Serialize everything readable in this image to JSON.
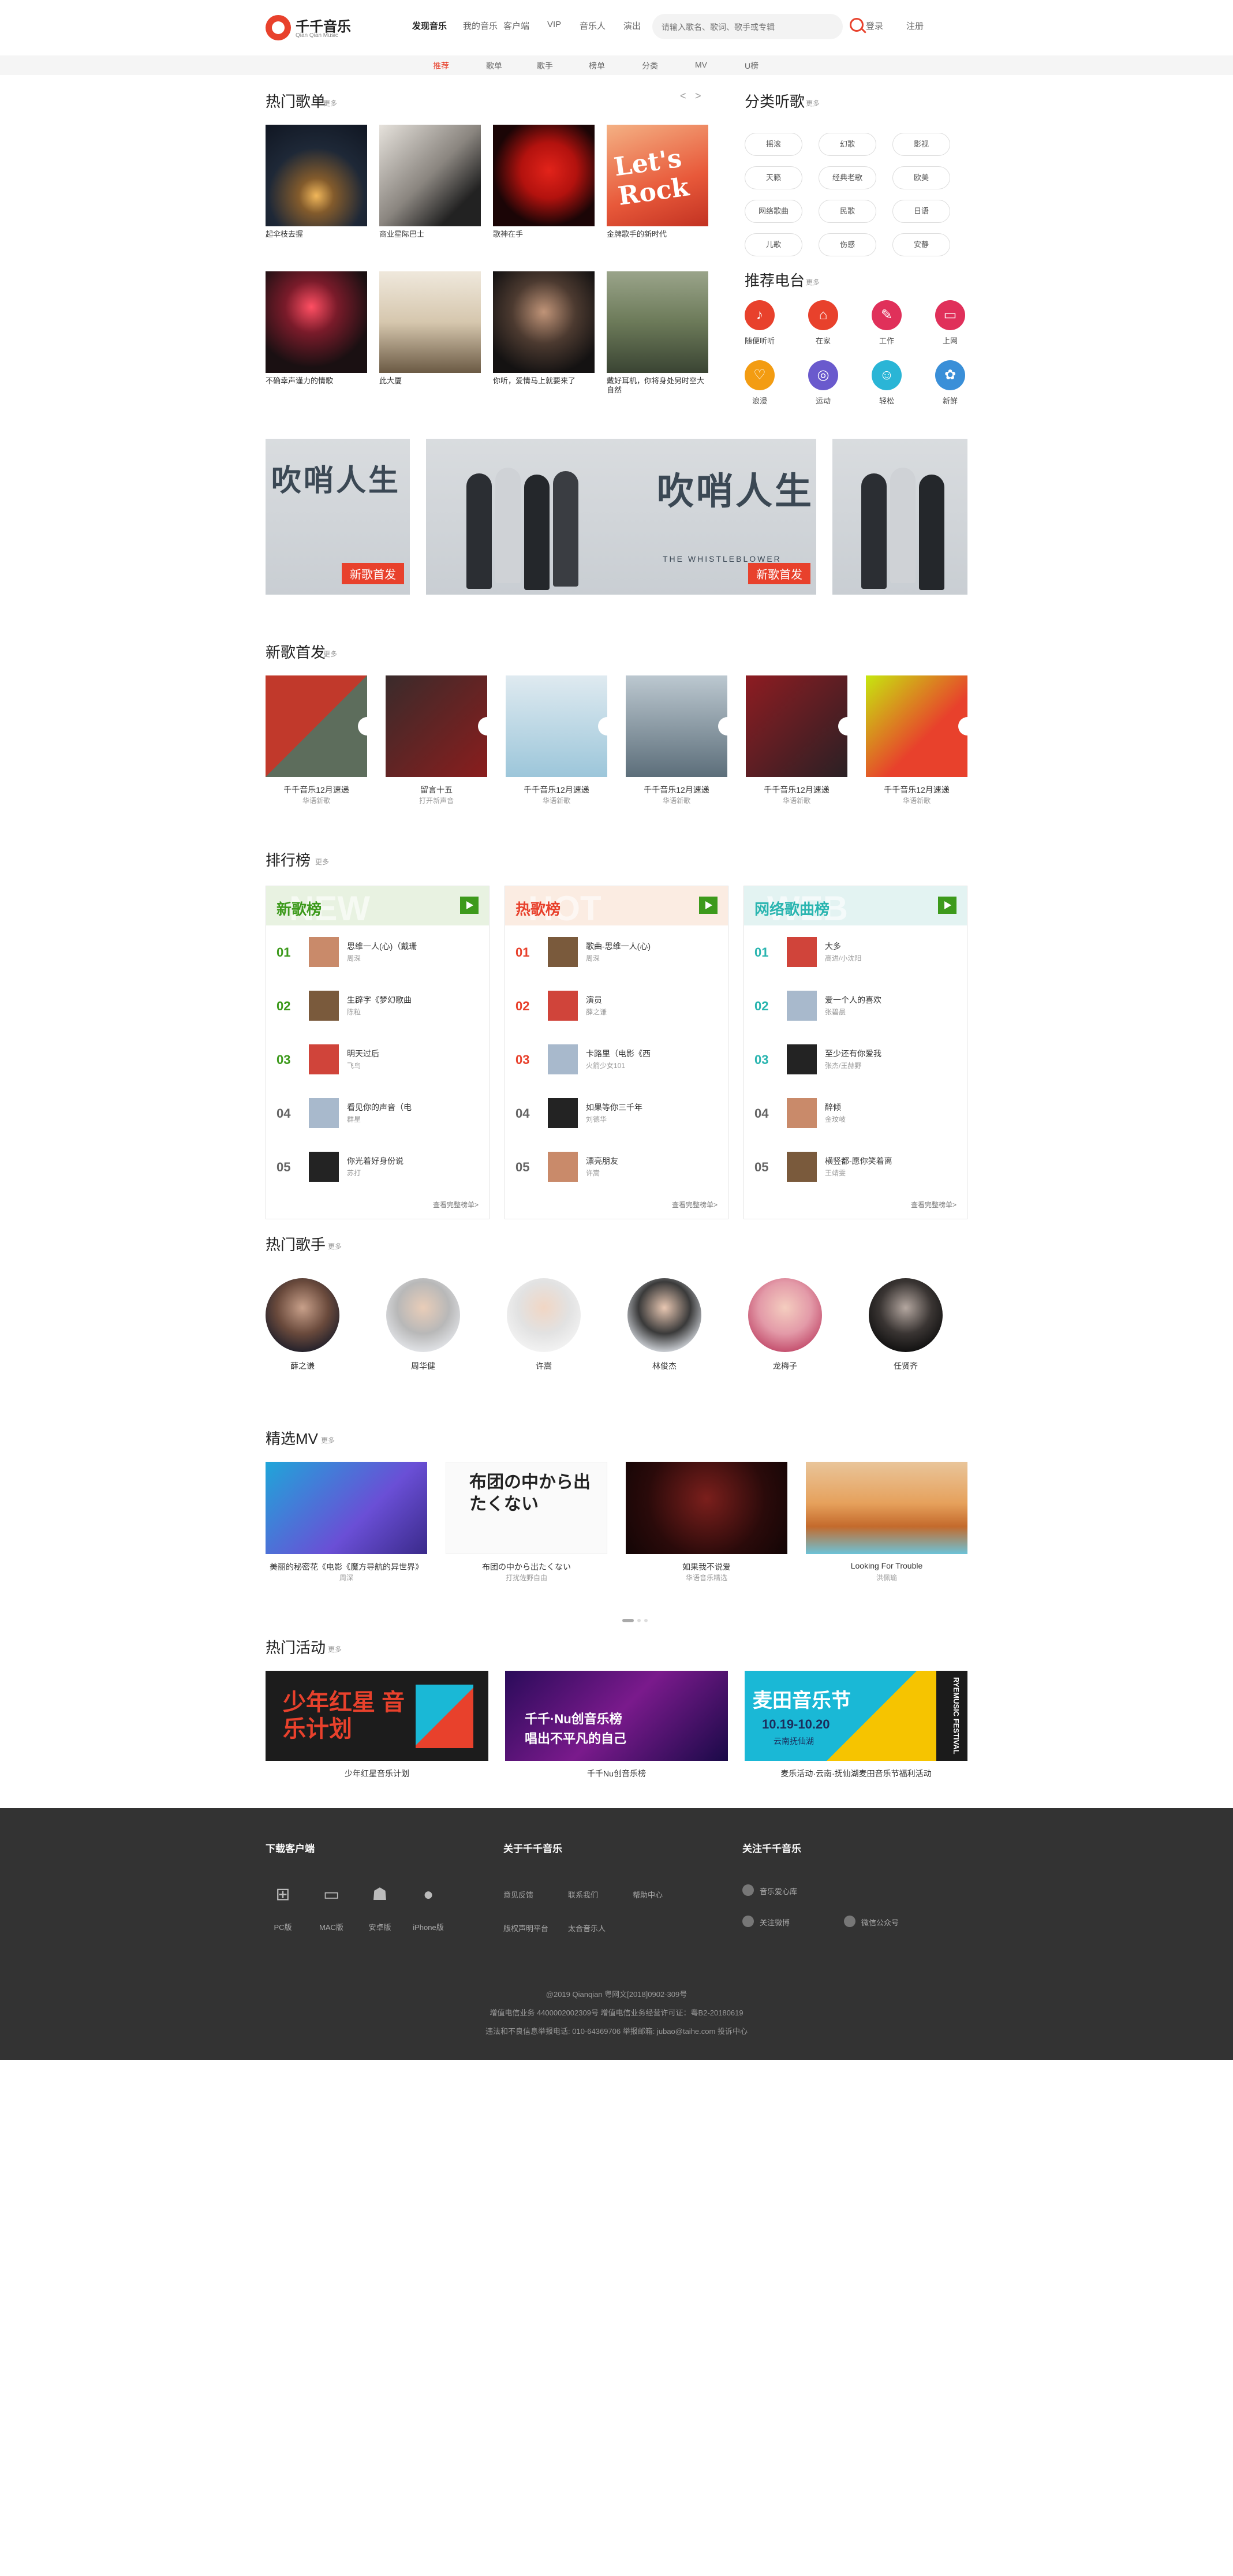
{
  "header": {
    "logo_cn": "千千音乐",
    "logo_en": "Qian Qian Music",
    "nav": [
      "发现音乐",
      "我的音乐",
      "客户端",
      "VIP",
      "音乐人",
      "演出"
    ],
    "search_placeholder": "请输入歌名、歌词、歌手或专辑",
    "login": "登录",
    "register": "注册"
  },
  "subnav": [
    "推荐",
    "歌单",
    "歌手",
    "榜单",
    "分类",
    "MV",
    "U榜"
  ],
  "more_label": "更多",
  "playlists": {
    "title": "热门歌单",
    "pager": [
      "<",
      ">"
    ],
    "items": [
      "起伞枝去握",
      "商业星际巴士",
      "歌神在手",
      "金牌歌手的新时代",
      "不确幸声谨力的情歌",
      "此大厦",
      "你听，爱情马上就要来了",
      "戴好耳机，你将身处另时空大自然"
    ]
  },
  "genres": {
    "title": "分类听歌",
    "items": [
      "摇滚",
      "幻歌",
      "影视",
      "天籁",
      "经典老歌",
      "欧美",
      "网络歌曲",
      "民歌",
      "日语",
      "儿歌",
      "伤感",
      "安静"
    ]
  },
  "radio": {
    "title": "推荐电台",
    "items": [
      {
        "label": "随便听听",
        "color": "#e8412c",
        "glyph": "♪"
      },
      {
        "label": "在家",
        "color": "#e8412c",
        "glyph": "⌂"
      },
      {
        "label": "工作",
        "color": "#e0305a",
        "glyph": "✎"
      },
      {
        "label": "上网",
        "color": "#e0305a",
        "glyph": "▭"
      },
      {
        "label": "浪漫",
        "color": "#f39c12",
        "glyph": "♡"
      },
      {
        "label": "运动",
        "color": "#6a5acd",
        "glyph": "◎"
      },
      {
        "label": "轻松",
        "color": "#2ab5d6",
        "glyph": "☺"
      },
      {
        "label": "新鲜",
        "color": "#3a8fd8",
        "glyph": "✿"
      }
    ]
  },
  "banner": {
    "title_cn": "吹哨人生",
    "title_en": "THE WHISTLEBLOWER",
    "badge": "新歌首发"
  },
  "new_songs": {
    "title": "新歌首发",
    "items": [
      {
        "title": "千千音乐12月速递",
        "sub": "华语新歌"
      },
      {
        "title": "留言十五",
        "sub": "打开新声音"
      },
      {
        "title": "千千音乐12月速递",
        "sub": "华语新歌"
      },
      {
        "title": "千千音乐12月速递",
        "sub": "华语新歌"
      },
      {
        "title": "千千音乐12月速递",
        "sub": "华语新歌"
      },
      {
        "title": "千千音乐12月速递",
        "sub": "华语新歌"
      }
    ]
  },
  "charts": {
    "title": "排行榜",
    "view_all": "查看完整榜单>",
    "boards": [
      {
        "name": "新歌榜",
        "watermark": "NEW",
        "accent": "#3d9a1c",
        "bg": "#e8f2e1",
        "rows": [
          {
            "num": "01",
            "song": "思维一人(心)（戴珊",
            "artist": "周深"
          },
          {
            "num": "02",
            "song": "生辟字《梦幻歌曲",
            "artist": "陈粒"
          },
          {
            "num": "03",
            "song": "明天过后",
            "artist": "飞鸟"
          },
          {
            "num": "04",
            "song": "看见你的声音（电",
            "artist": "群星"
          },
          {
            "num": "05",
            "song": "你光着好身份说",
            "artist": "苏打"
          }
        ]
      },
      {
        "name": "热歌榜",
        "watermark": "HOT",
        "accent": "#e8412c",
        "bg": "#fbece2",
        "rows": [
          {
            "num": "01",
            "song": "歌曲-思维一人(心)",
            "artist": "周深"
          },
          {
            "num": "02",
            "song": "演员",
            "artist": "薛之谦"
          },
          {
            "num": "03",
            "song": "卡路里（电影《西",
            "artist": "火箭少女101"
          },
          {
            "num": "04",
            "song": "如果等你三千年",
            "artist": "刘德华"
          },
          {
            "num": "05",
            "song": "漂亮朋友",
            "artist": "许嵩"
          }
        ]
      },
      {
        "name": "网络歌曲榜",
        "watermark": "WEB",
        "accent": "#2ab5b0",
        "bg": "#e3f3f2",
        "rows": [
          {
            "num": "01",
            "song": "大多",
            "artist": "高进/小沈阳"
          },
          {
            "num": "02",
            "song": "爱一个人的喜欢",
            "artist": "张碧晨"
          },
          {
            "num": "03",
            "song": "至少还有你爱我",
            "artist": "张杰/王赫野"
          },
          {
            "num": "04",
            "song": "醉倾",
            "artist": "金玟岐"
          },
          {
            "num": "05",
            "song": "横竖都-愿你笑着离",
            "artist": "王靖雯"
          }
        ]
      }
    ]
  },
  "singers": {
    "title": "热门歌手",
    "items": [
      "薛之谦",
      "周华健",
      "许嵩",
      "林俊杰",
      "龙梅子",
      "任贤齐"
    ]
  },
  "mv": {
    "title": "精选MV",
    "items": [
      {
        "title": "美丽的秘密花《电影《魔方导航的异世界》",
        "sub": "周深"
      },
      {
        "title": "布团の中から出たくない",
        "sub": "打扰佐野自由"
      },
      {
        "title": "如果我不说爱",
        "sub": "华语音乐精选"
      },
      {
        "title": "Looking For Trouble",
        "sub": "洪佩瑜"
      }
    ]
  },
  "activities": {
    "title": "热门活动",
    "items": [
      "少年红星音乐计划",
      "千千Nu创音乐榜",
      "麦乐活动·云南·抚仙湖麦田音乐节福利活动"
    ],
    "banner1": "少年红星 音乐计划",
    "banner2_top": "千千·Nu创音乐榜",
    "banner2_bottom": "唱出不平凡的自己",
    "banner3_title": "麦田音乐节",
    "banner3_date": "10.19-10.20",
    "banner3_loc": "云南抚仙湖",
    "banner3_side": "RYEMUSIC FESTIVAL"
  },
  "footer": {
    "col1_title": "下载客户端",
    "clients": [
      {
        "label": "PC版",
        "icon": "windows-icon",
        "glyph": "⊞"
      },
      {
        "label": "MAC版",
        "icon": "monitor-icon",
        "glyph": "▭"
      },
      {
        "label": "安卓版",
        "icon": "android-icon",
        "glyph": "☗"
      },
      {
        "label": "iPhone版",
        "icon": "apple-icon",
        "glyph": "●"
      }
    ],
    "col2_title": "关于千千音乐",
    "about_links": [
      "意见反馈",
      "联系我们",
      "帮助中心",
      "版权声明平台",
      "太合音乐人"
    ],
    "col3_title": "关注千千音乐",
    "follow": [
      "音乐爱心库",
      "关注微博",
      "微信公众号"
    ],
    "copyright": [
      "@2019 Qianqian 粤网文[2018]0902-309号",
      "增值电信业务 4400002002309号 增值电信业务经营许可证：粤B2-20180619",
      "违法和不良信息举报电话: 010-64369706 举报邮箱: jubao@taihe.com 投诉中心"
    ]
  }
}
